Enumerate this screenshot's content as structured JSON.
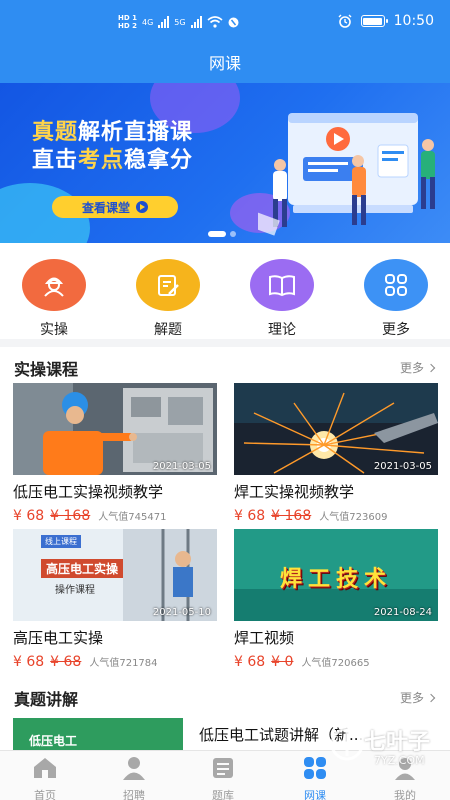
{
  "status_bar": {
    "hd1": "HD 1",
    "hd2": "HD 2",
    "net1": "4G",
    "net2": "5G",
    "time": "10:50"
  },
  "header": {
    "title": "网课"
  },
  "banner": {
    "line1_a": "真题",
    "line1_b": "解析直播课",
    "line2_a": "直击",
    "line2_b": "考点",
    "line2_c": "稳拿分",
    "button": "查看课堂"
  },
  "quick_menu": [
    {
      "label": "实操",
      "color": "#f26a3f",
      "icon": "worker-icon"
    },
    {
      "label": "解题",
      "color": "#f6b41c",
      "icon": "edit-icon"
    },
    {
      "label": "理论",
      "color": "#9b6cf2",
      "icon": "book-icon"
    },
    {
      "label": "更多",
      "color": "#3d92f5",
      "icon": "grid-icon"
    }
  ],
  "practical": {
    "title": "实操课程",
    "more": "更多",
    "courses": [
      {
        "title": "低压电工实操视频教学",
        "price": "¥ 68",
        "old": "¥ 168",
        "popularity": "人气值745471",
        "date": "2021-03-05"
      },
      {
        "title": "焊工实操视频教学",
        "price": "¥ 68",
        "old": "¥ 168",
        "popularity": "人气值723609",
        "date": "2021-03-05"
      },
      {
        "title": "高压电工实操",
        "price": "¥ 68",
        "old": "¥ 68",
        "popularity": "人气值721784",
        "date": "2021-05-10",
        "thumb_text1": "高压电工实操",
        "thumb_text2": "操作课程",
        "thumb_tag": "线上课程"
      },
      {
        "title": "焊工视频",
        "price": "¥ 68",
        "old": "¥ 0",
        "popularity": "人气值720665",
        "date": "2021-08-24",
        "thumb_text1": "焊工技术"
      }
    ]
  },
  "exam": {
    "title": "真题讲解",
    "more": "更多",
    "item_title": "低压电工试题讲解（新...",
    "thumb_text": "低压电工"
  },
  "tabbar": [
    {
      "label": "首页",
      "icon": "home-icon"
    },
    {
      "label": "招聘",
      "icon": "person-icon"
    },
    {
      "label": "题库",
      "icon": "notebook-icon"
    },
    {
      "label": "网课",
      "icon": "course-icon",
      "active": true
    },
    {
      "label": "我的",
      "icon": "profile-icon"
    }
  ],
  "watermark": {
    "main": "七叶子",
    "sub": "7YZ.COM"
  },
  "colors": {
    "primary": "#2f8df2",
    "price": "#e8442b",
    "accent": "#ffcf2e"
  }
}
